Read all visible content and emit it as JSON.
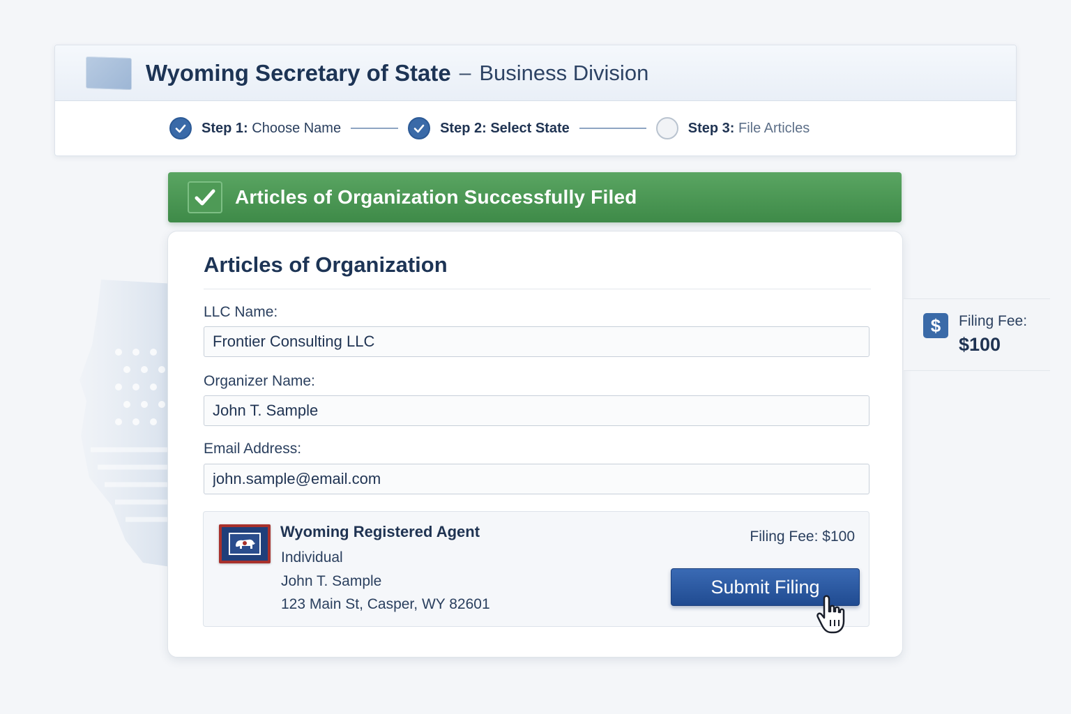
{
  "header": {
    "title": "Wyoming Secretary of State",
    "separator": "–",
    "subtitle": "Business Division"
  },
  "stepper": {
    "steps": [
      {
        "prefix": "Step 1:",
        "label": "Choose Name",
        "status": "complete"
      },
      {
        "prefix": "Step 2:",
        "label": "Select State",
        "status": "complete"
      },
      {
        "prefix": "Step 3:",
        "label": "File Articles",
        "status": "pending"
      }
    ]
  },
  "banner": {
    "message": "Articles of Organization Successfully Filed",
    "color": "#4a9953"
  },
  "form": {
    "title": "Articles of Organization",
    "fields": [
      {
        "label": "LLC Name:",
        "value": "Frontier Consulting LLC"
      },
      {
        "label": "Organizer Name:",
        "value": "John T. Sample"
      },
      {
        "label": "Email Address:",
        "value": "john.sample@email.com"
      }
    ]
  },
  "agent": {
    "title": "Wyoming Registered Agent",
    "type": "Individual",
    "name": "John T. Sample",
    "address": "123 Main St, Casper, WY 82601",
    "fee": "Filing Fee: $100",
    "submit_label": "Submit Filing",
    "flag_icon": "wyoming-flag-icon"
  },
  "side_fee": {
    "label": "Filing Fee:",
    "amount": "$100",
    "icon": "dollar-icon"
  },
  "colors": {
    "accent": "#3a6aa8",
    "success": "#4a9953",
    "button": "#2a559f"
  }
}
